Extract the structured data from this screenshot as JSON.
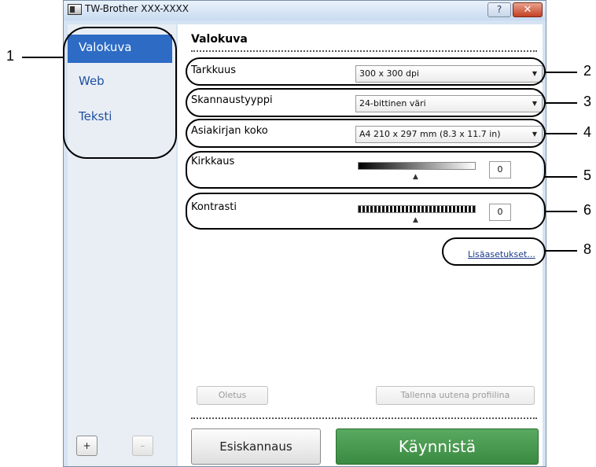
{
  "window": {
    "title": "TW-Brother XXX-XXXX",
    "help_label": "?",
    "close_label": "✕"
  },
  "sidebar": {
    "items": [
      {
        "label": "Valokuva",
        "selected": true
      },
      {
        "label": "Web",
        "selected": false
      },
      {
        "label": "Teksti",
        "selected": false
      }
    ],
    "add_label": "+",
    "remove_label": "–"
  },
  "main": {
    "section_title": "Valokuva",
    "resolution": {
      "label": "Tarkkuus",
      "value": "300 x 300 dpi"
    },
    "scan_type": {
      "label": "Skannaustyyppi",
      "value": "24-bittinen väri"
    },
    "document_size": {
      "label": "Asiakirjan koko",
      "value": "A4 210 x 297 mm (8.3 x 11.7 in)"
    },
    "brightness": {
      "label": "Kirkkaus",
      "value": "0"
    },
    "contrast": {
      "label": "Kontrasti",
      "value": "0"
    },
    "advanced_link": "Lisäasetukset...",
    "default_button": "Oletus",
    "save_profile_button": "Tallenna uutena profiilina",
    "prescan_button": "Esiskannaus",
    "start_button": "Käynnistä"
  },
  "callouts": [
    "1",
    "2",
    "3",
    "4",
    "5",
    "6",
    "8"
  ],
  "colors": {
    "selected_item_bg": "#2d6bc4",
    "start_button_bg": "#3b8a42",
    "sidebar_link": "#1f4fa0",
    "close_button": "#c33f22"
  }
}
